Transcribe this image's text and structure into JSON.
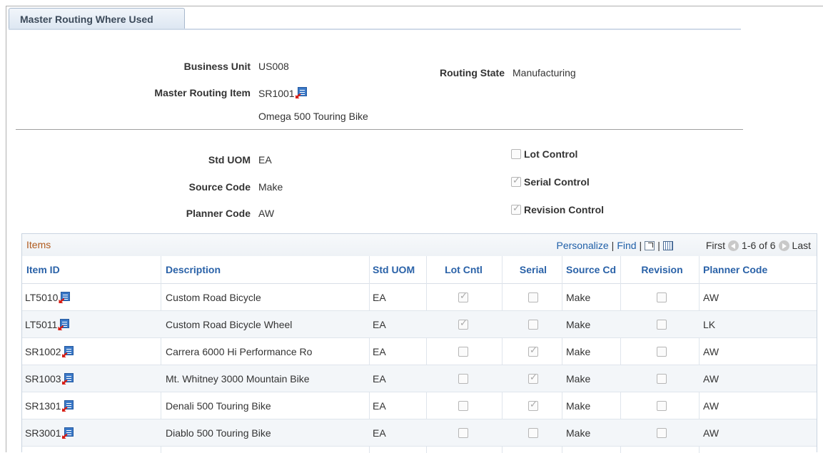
{
  "tab": {
    "label": "Master Routing Where Used"
  },
  "header": {
    "business_unit_label": "Business Unit",
    "business_unit_value": "US008",
    "routing_state_label": "Routing State",
    "routing_state_value": "Manufacturing",
    "master_item_label": "Master Routing Item",
    "master_item_value": "SR1001",
    "master_item_desc": "Omega 500 Touring Bike"
  },
  "attributes": {
    "std_uom_label": "Std UOM",
    "std_uom_value": "EA",
    "source_code_label": "Source Code",
    "source_code_value": "Make",
    "planner_code_label": "Planner Code",
    "planner_code_value": "AW",
    "lot_control_label": "Lot Control",
    "lot_control_checked": false,
    "serial_control_label": "Serial Control",
    "serial_control_checked": true,
    "revision_control_label": "Revision Control",
    "revision_control_checked": true
  },
  "grid": {
    "title": "Items",
    "personalize": "Personalize",
    "find": "Find",
    "first": "First",
    "range": "1-6 of 6",
    "last": "Last",
    "columns": [
      "Item ID",
      "Description",
      "Std UOM",
      "Lot Cntl",
      "Serial",
      "Source Cd",
      "Revision",
      "Planner Code"
    ],
    "rows": [
      {
        "item_id": "LT5010",
        "description": "Custom Road Bicycle",
        "uom": "EA",
        "lot": true,
        "serial": false,
        "source": "Make",
        "revision": false,
        "planner": "AW"
      },
      {
        "item_id": "LT5011",
        "description": "Custom Road Bicycle Wheel",
        "uom": "EA",
        "lot": true,
        "serial": false,
        "source": "Make",
        "revision": false,
        "planner": "LK"
      },
      {
        "item_id": "SR1002",
        "description": "Carrera 6000 Hi Performance Ro",
        "uom": "EA",
        "lot": false,
        "serial": true,
        "source": "Make",
        "revision": false,
        "planner": "AW"
      },
      {
        "item_id": "SR1003",
        "description": "Mt. Whitney 3000 Mountain Bike",
        "uom": "EA",
        "lot": false,
        "serial": true,
        "source": "Make",
        "revision": false,
        "planner": "AW"
      },
      {
        "item_id": "SR1301",
        "description": "Denali 500 Touring Bike",
        "uom": "EA",
        "lot": false,
        "serial": true,
        "source": "Make",
        "revision": false,
        "planner": "AW"
      },
      {
        "item_id": "SR3001",
        "description": "Diablo 500 Touring Bike",
        "uom": "EA",
        "lot": false,
        "serial": false,
        "source": "Make",
        "revision": false,
        "planner": "AW"
      }
    ]
  }
}
